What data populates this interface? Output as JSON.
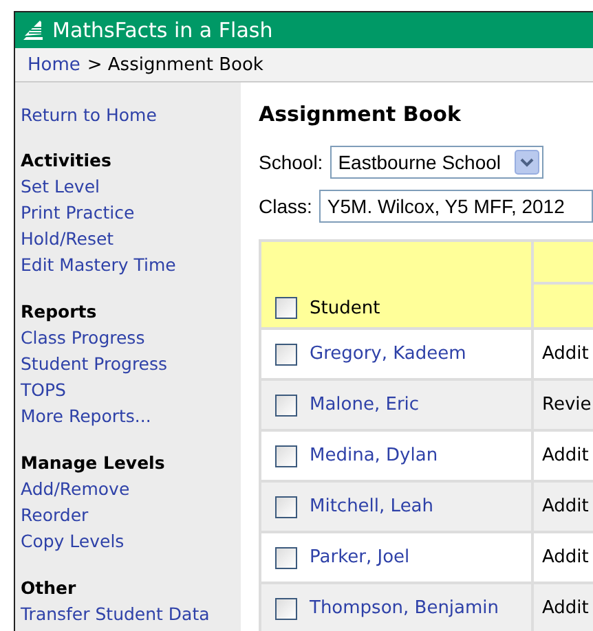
{
  "app": {
    "title": "MathsFacts in a Flash"
  },
  "breadcrumb": {
    "link": "Home",
    "current": "> Assignment Book"
  },
  "sidebar": {
    "top_link": "Return to Home",
    "sections": [
      {
        "heading": "Activities",
        "links": [
          "Set Level",
          "Print Practice",
          "Hold/Reset",
          "Edit Mastery Time"
        ]
      },
      {
        "heading": "Reports",
        "links": [
          "Class Progress",
          "Student Progress",
          "TOPS",
          "More Reports..."
        ]
      },
      {
        "heading": "Manage Levels",
        "links": [
          "Add/Remove",
          "Reorder",
          "Copy Levels"
        ]
      },
      {
        "heading": "Other",
        "links": [
          "Transfer Student Data"
        ]
      }
    ]
  },
  "main": {
    "title": "Assignment Book",
    "school": {
      "label": "School:",
      "value": "Eastbourne School"
    },
    "class": {
      "label": "Class:",
      "value": "Y5M. Wilcox, Y5 MFF, 2012"
    },
    "table": {
      "header": {
        "label": "Student",
        "checked": false
      },
      "rows": [
        {
          "name": "Gregory, Kadeem",
          "checked": false,
          "column_2": "Addit"
        },
        {
          "name": "Malone, Eric",
          "checked": false,
          "column_2": "Revie"
        },
        {
          "name": "Medina, Dylan",
          "checked": false,
          "column_2": "Addit"
        },
        {
          "name": "Mitchell, Leah",
          "checked": false,
          "column_2": "Addit"
        },
        {
          "name": "Parker, Joel",
          "checked": false,
          "column_2": "Addit"
        },
        {
          "name": "Thompson, Benjamin",
          "checked": false,
          "column_2": "Addit"
        }
      ]
    }
  }
}
